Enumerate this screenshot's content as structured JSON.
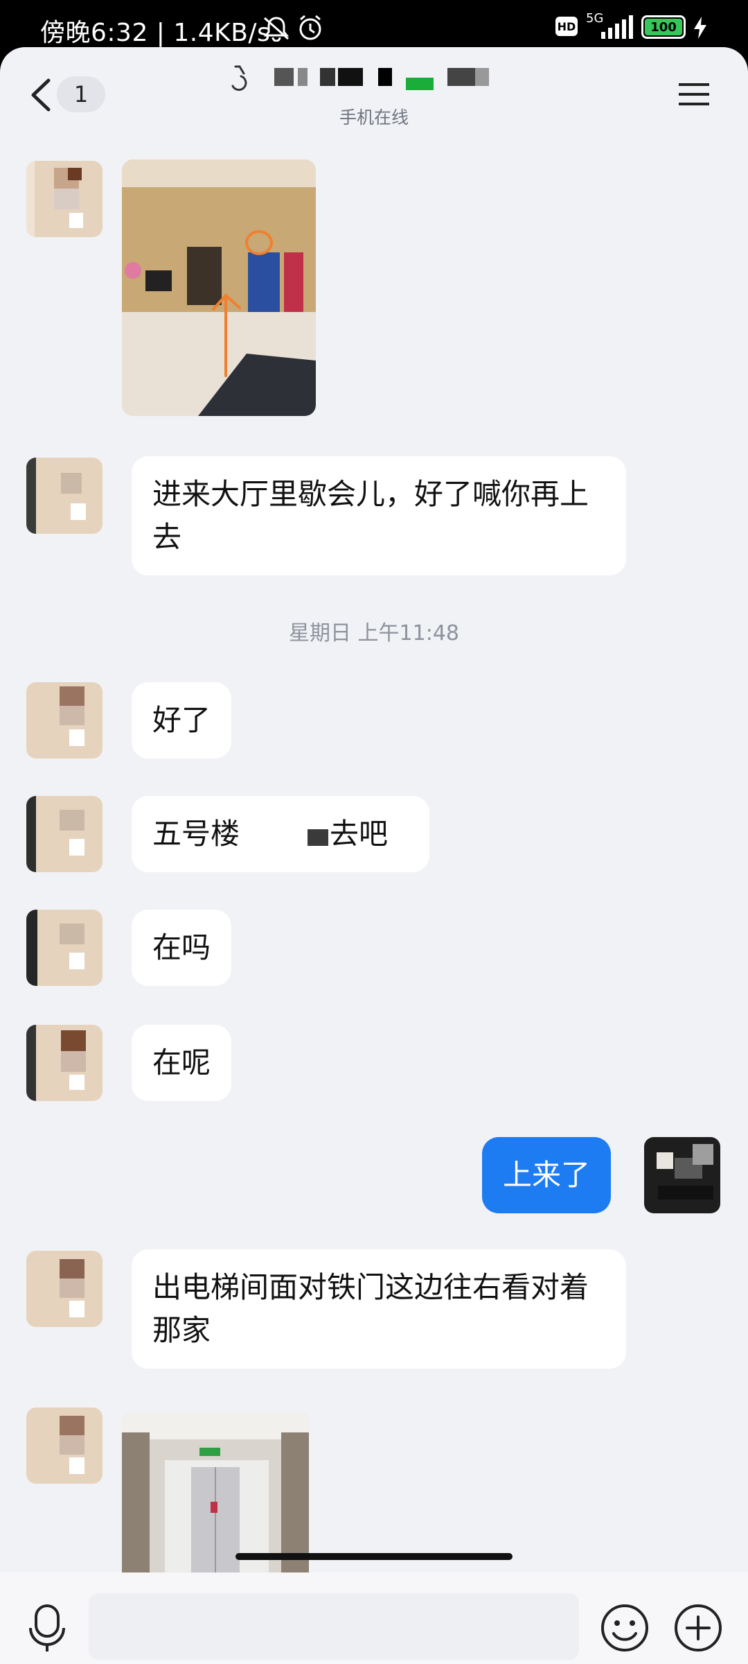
{
  "status_bar": {
    "time": "傍晚6:32 | 1.4KB/s",
    "battery": "100",
    "network": "5G",
    "hd": "HD"
  },
  "header": {
    "unread_count": "1",
    "contact_status": "手机在线"
  },
  "messages": [
    {
      "type": "image",
      "from": "other"
    },
    {
      "type": "text",
      "from": "other",
      "text": "进来大厅里歇会儿，好了喊你再上去"
    },
    {
      "type": "timestamp",
      "text": "星期日 上午11:48"
    },
    {
      "type": "text",
      "from": "other",
      "text": "好了"
    },
    {
      "type": "text",
      "from": "other",
      "text": "五号楼"
    },
    {
      "type": "text",
      "from": "other",
      "text": "在吗"
    },
    {
      "type": "text",
      "from": "other",
      "text": "在呢"
    },
    {
      "type": "text",
      "from": "me",
      "text": "上来了"
    },
    {
      "type": "text",
      "from": "other",
      "text": "出电梯间面对铁门这边往右看对着那家"
    },
    {
      "type": "image",
      "from": "other"
    }
  ],
  "message_5_suffix": "去吧",
  "input": {
    "placeholder": ""
  },
  "colors": {
    "accent": "#1E7CF2",
    "background": "#F1F2F6",
    "bubble": "#FFFFFF"
  },
  "icons": [
    "back-icon",
    "menu-icon",
    "mic-icon",
    "emoji-icon",
    "plus-icon",
    "chevron-down-icon"
  ]
}
